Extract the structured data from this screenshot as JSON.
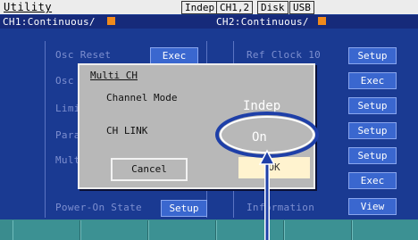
{
  "header": {
    "title": "Utility",
    "badges": [
      "Indep",
      "CH1,2",
      "Disk",
      "USB"
    ],
    "ch1": "CH1:Continuous/",
    "ch2": "CH2:Continuous/"
  },
  "left_panel": {
    "osc_reset_label": "Osc Reset",
    "osc_reset_button": "Exec",
    "row2_label": "Osc",
    "row3_label": "Limi",
    "row4_label": "Para",
    "row5_label": "Mult",
    "power_on_label": "Power-On State",
    "power_on_button": "Setup"
  },
  "right_panel": {
    "ref_clock_label": "Ref Clock 10",
    "information_label": "Information",
    "buttons": [
      "Setup",
      "Exec",
      "Setup",
      "Setup",
      "Setup",
      "Exec",
      "View"
    ]
  },
  "dialog": {
    "title": "Multi CH",
    "channel_mode_label": "Channel Mode",
    "channel_mode_value": "Indep",
    "ch_link_label": "CH LINK",
    "ch_link_value": "On",
    "cancel_label": "Cancel",
    "ok_label": "OK"
  },
  "colors": {
    "screen_bg": "#1a3a92",
    "button_blue": "#3a67cf",
    "dialog_gray": "#b8b8b8",
    "highlight_orange": "#f08a1c",
    "annotation_blue": "#1e3fa8",
    "softkey_teal": "#3a8c8e"
  }
}
